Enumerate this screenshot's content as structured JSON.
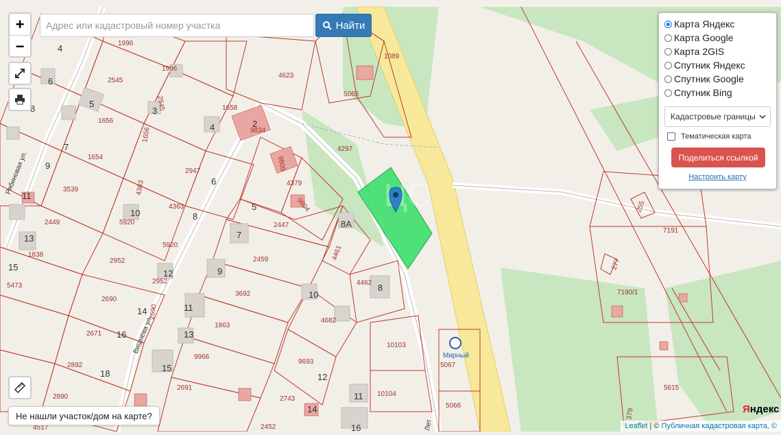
{
  "search": {
    "placeholder": "Адрес или кадастровый номер участка",
    "button_label": "Найти"
  },
  "zoom": {
    "in_label": "+",
    "out_label": "−"
  },
  "layers_panel": {
    "base_layers": [
      {
        "label": "Карта Яндекс",
        "selected": true
      },
      {
        "label": "Карта Google",
        "selected": false
      },
      {
        "label": "Карта 2GIS",
        "selected": false
      },
      {
        "label": "Спутник Яндекс",
        "selected": false
      },
      {
        "label": "Спутник Google",
        "selected": false
      },
      {
        "label": "Спутник Bing",
        "selected": false
      }
    ],
    "overlay_select": "Кадастровые границы",
    "thematic_label": "Тематическая карта",
    "thematic_checked": false,
    "share_button": "Поделиться ссылкой",
    "configure_link": "Настроить карту"
  },
  "not_found_button": "Не нашли участок/дом на карте?",
  "attribution": {
    "leaflet": "Leaflet",
    "separator": "| ©",
    "pkk": "Публичная кадастровая карта, ©"
  },
  "yandex_logo": {
    "first": "Я",
    "rest": "ндекс"
  },
  "map": {
    "streets": [
      "Рябиновая ул.",
      "Вишнёва ул.",
      "Лет"
    ],
    "stop_label": "Мирный",
    "parcel_numbers": [
      "1996",
      "1996",
      "2545",
      "2545",
      "1656",
      "1656",
      "1654",
      "3539",
      "2449",
      "1838",
      "5473",
      "4623",
      "1089",
      "5065",
      "1658",
      "9834",
      "4297",
      "4363",
      "4363",
      "5920",
      "5920",
      "2947",
      "2952",
      "2952",
      "2690",
      "2690",
      "2671",
      "2892",
      "2890",
      "4379",
      "9804",
      "2447",
      "2459",
      "3692",
      "1863",
      "9966",
      "2691",
      "9805",
      "4461",
      "4462",
      "4682",
      "9693",
      "2743",
      "2452",
      "10103",
      "10104",
      "5067",
      "5066",
      "4517",
      "7191",
      "7190/1",
      "5615",
      "255",
      "277",
      "379"
    ],
    "house_numbers": [
      "4",
      "6",
      "8",
      "5",
      "3",
      "4",
      "7",
      "9",
      "6",
      "10",
      "8",
      "13",
      "15",
      "12",
      "14",
      "16",
      "11",
      "13",
      "18",
      "15",
      "7",
      "9",
      "10",
      "8",
      "12",
      "11",
      "14",
      "16",
      "5",
      "8А",
      "11",
      "2"
    ]
  },
  "colors": {
    "accent": "#337ab7",
    "share": "#d9534f",
    "parcel_line": "#c0392b",
    "highlight": "#33dd66",
    "forest": "#c8e6c0",
    "road": "#f7e89a"
  }
}
